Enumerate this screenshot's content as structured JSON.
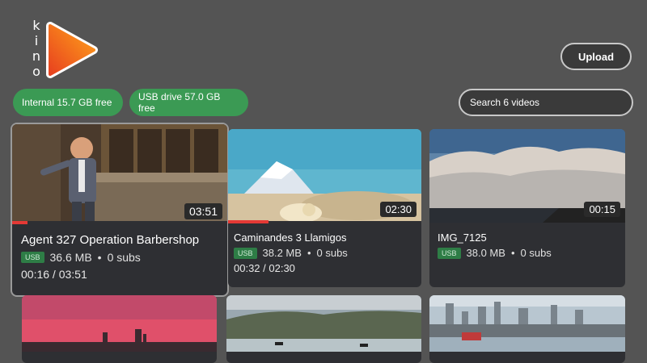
{
  "app": {
    "logo_text": "kino"
  },
  "header": {
    "upload_label": "Upload"
  },
  "storage": {
    "internal": "Internal 15.7 GB free",
    "usb": "USB drive 57.0 GB free"
  },
  "search": {
    "placeholder": "Search 6 videos"
  },
  "colors": {
    "background": "#545454",
    "card": "#2e2f33",
    "chip": "#3b9a54",
    "progress": "#e53935",
    "badge": "#2e7d46"
  },
  "videos": [
    {
      "title": "Agent 327 Operation Barbershop",
      "badge": "USB",
      "size": "36.6 MB",
      "subs": "0 subs",
      "duration": "03:51",
      "position": "00:16 / 03:51",
      "progress_fraction": 0.07
    },
    {
      "title": "Caminandes 3 Llamigos",
      "badge": "USB",
      "size": "38.2 MB",
      "subs": "0 subs",
      "duration": "02:30",
      "position": "00:32 / 02:30",
      "progress_fraction": 0.21
    },
    {
      "title": "IMG_7125",
      "badge": "USB",
      "size": "38.0 MB",
      "subs": "0 subs",
      "duration": "00:15"
    },
    {
      "title": "",
      "duration": ""
    },
    {
      "title": "",
      "duration": ""
    },
    {
      "title": "",
      "duration": ""
    }
  ]
}
